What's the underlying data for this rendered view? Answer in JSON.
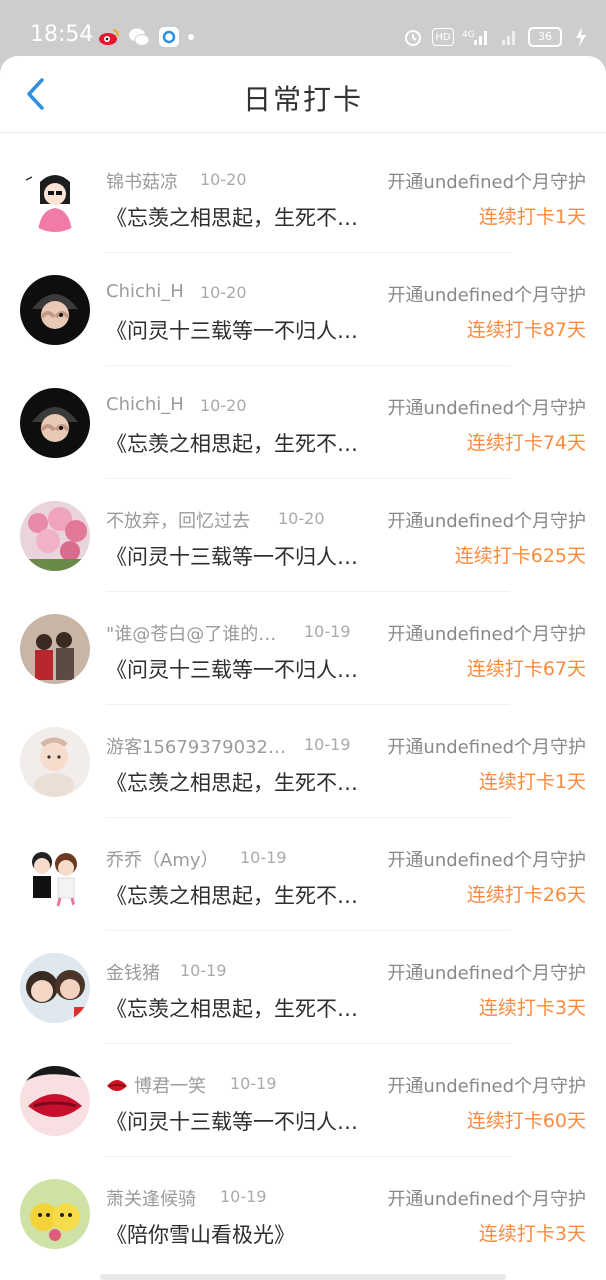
{
  "status_bar": {
    "time": "18:54",
    "battery": "36",
    "icons_left": [
      "weibo-icon",
      "wechat-icon",
      "app-icon",
      "dot"
    ],
    "icons_right": [
      "alarm-icon",
      "hd-icon",
      "4g-signal-icon",
      "signal-icon",
      "battery-icon",
      "charging-icon"
    ],
    "hd": "HD",
    "net": "4G"
  },
  "header": {
    "title": "日常打卡",
    "back_icon": "chevron-left-icon"
  },
  "colors": {
    "accent_blue": "#2f8fe0",
    "streak_orange": "#ff8a3d"
  },
  "checkins": [
    {
      "name": "锦书菇凉",
      "date": "10-20",
      "guard": "开通undefined个月守护",
      "book": "《忘羡之相思起，生死不…",
      "streak": "连续打卡1天"
    },
    {
      "name": "Chichi_H",
      "date": "10-20",
      "guard": "开通undefined个月守护",
      "book": "《问灵十三载等一不归人…",
      "streak": "连续打卡87天"
    },
    {
      "name": "Chichi_H",
      "date": "10-20",
      "guard": "开通undefined个月守护",
      "book": "《忘羡之相思起，生死不…",
      "streak": "连续打卡74天"
    },
    {
      "name": "不放弃，回忆过去",
      "date": "10-20",
      "guard": "开通undefined个月守护",
      "book": "《问灵十三载等一不归人…",
      "streak": "连续打卡625天"
    },
    {
      "name": "\"谁@苍白@了谁的…",
      "date": "10-19",
      "guard": "开通undefined个月守护",
      "book": "《问灵十三载等一不归人…",
      "streak": "连续打卡67天"
    },
    {
      "name": "游客15679379032…",
      "date": "10-19",
      "guard": "开通undefined个月守护",
      "book": "《忘羡之相思起，生死不…",
      "streak": "连续打卡1天"
    },
    {
      "name": "乔乔（Amy）",
      "date": "10-19",
      "guard": "开通undefined个月守护",
      "book": "《忘羡之相思起，生死不…",
      "streak": "连续打卡26天"
    },
    {
      "name": "金钱猪",
      "date": "10-19",
      "guard": "开通undefined个月守护",
      "book": "《忘羡之相思起，生死不…",
      "streak": "连续打卡3天"
    },
    {
      "name": "博君一笑",
      "date": "10-19",
      "guard": "开通undefined个月守护",
      "book": "《问灵十三载等一不归人…",
      "streak": "连续打卡60天"
    },
    {
      "name": "萧关逢候骑",
      "date": "10-19",
      "guard": "开通undefined个月守护",
      "book": "《陪你雪山看极光》",
      "streak": "连续打卡3天"
    }
  ]
}
